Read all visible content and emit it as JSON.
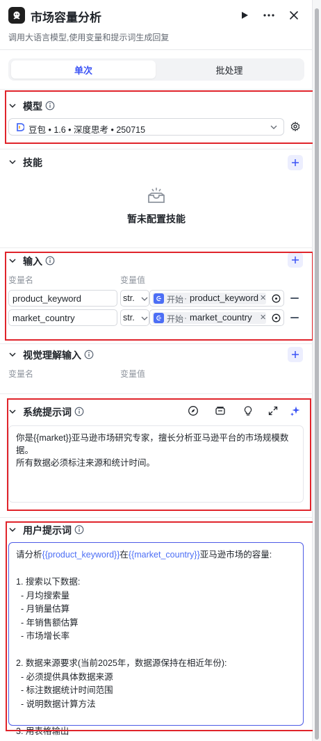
{
  "header": {
    "title": "市场容量分析",
    "subtitle": "调用大语言模型,使用变量和提示词生成回复"
  },
  "tabs": [
    {
      "label": "单次",
      "active": true
    },
    {
      "label": "批处理",
      "active": false
    }
  ],
  "model": {
    "title": "模型",
    "selected": "豆包 • 1.6 • 深度思考 • 250715"
  },
  "skills": {
    "title": "技能",
    "empty_text": "暂未配置技能"
  },
  "inputs": {
    "title": "输入",
    "col_name": "变量名",
    "col_value": "变量值",
    "rows": [
      {
        "name": "product_keyword",
        "type": "str.",
        "node": "开始",
        "var": "product_keyword"
      },
      {
        "name": "market_country",
        "type": "str.",
        "node": "开始",
        "var": "market_country"
      }
    ]
  },
  "vision": {
    "title": "视觉理解输入",
    "col_name": "变量名",
    "col_value": "变量值"
  },
  "system_prompt": {
    "title": "系统提示词",
    "line1": "你是{{market}}亚马逊市场研究专家，擅长分析亚马逊平台的市场规模数",
    "line2": "据。",
    "line3": "所有数据必须标注来源和统计时间。"
  },
  "user_prompt": {
    "title": "用户提示词",
    "intro_pre": "请分析",
    "intro_var1": "{{product_keyword}}",
    "intro_mid": "在",
    "intro_var2": "{{market_country}}",
    "intro_post": "亚马逊市场的容量:",
    "lines": [
      "",
      "1. 搜索以下数据:",
      "  - 月均搜索量",
      "  - 月销量估算",
      "  - 年销售额估算",
      "  - 市场增长率",
      "",
      "2. 数据来源要求(当前2025年，数据源保持在相近年份):",
      "  - 必须提供具体数据来源",
      "  - 标注数据统计时间范围",
      "  - 说明数据计算方法",
      "",
      "3. 用表格输出"
    ]
  },
  "colors": {
    "accent": "#3b53f5",
    "highlight_border": "#e0242b"
  }
}
